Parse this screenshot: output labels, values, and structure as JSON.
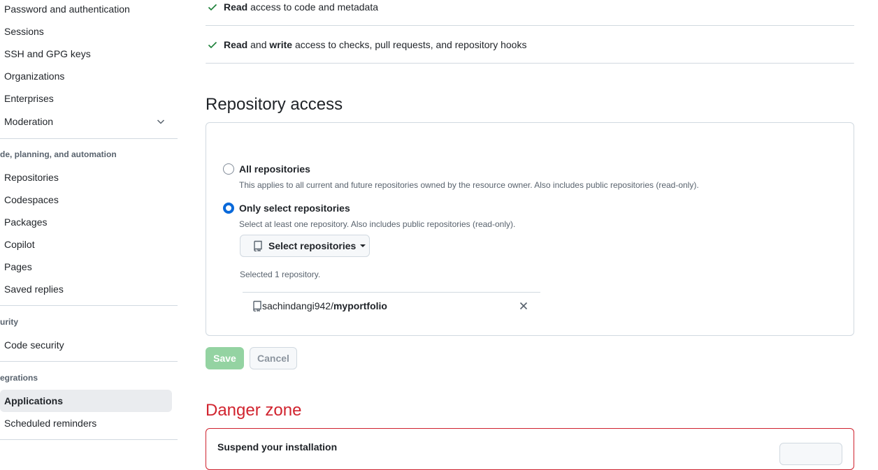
{
  "sidebar": {
    "items_top": [
      {
        "label": "Password and authentication"
      },
      {
        "label": "Sessions"
      },
      {
        "label": "SSH and GPG keys"
      },
      {
        "label": "Organizations"
      },
      {
        "label": "Enterprises"
      },
      {
        "label": "Moderation"
      }
    ],
    "heading_code": "de, planning, and automation",
    "items_code": [
      {
        "label": "Repositories"
      },
      {
        "label": "Codespaces"
      },
      {
        "label": "Packages"
      },
      {
        "label": "Copilot"
      },
      {
        "label": "Pages"
      },
      {
        "label": "Saved replies"
      }
    ],
    "heading_security": "urity",
    "items_security": [
      {
        "label": "Code security"
      }
    ],
    "heading_integrations": "egrations",
    "items_integrations": [
      {
        "label": "Applications",
        "active": true
      },
      {
        "label": "Scheduled reminders"
      }
    ]
  },
  "permissions": {
    "row1": {
      "strong": "Read",
      "rest": " access to code and metadata"
    },
    "row2": {
      "strong1": "Read",
      "mid": " and ",
      "strong2": "write",
      "rest": " access to checks, pull requests, and repository hooks"
    }
  },
  "repo_access": {
    "title": "Repository access",
    "all": {
      "label": "All repositories",
      "note": "This applies to all current and future repositories owned by the resource owner. Also includes public repositories (read-only).",
      "checked": false
    },
    "select": {
      "label": "Only select repositories",
      "note": "Select at least one repository. Also includes public repositories (read-only).",
      "checked": true
    },
    "select_button": "Select repositories",
    "selected_count": "Selected 1 repository.",
    "selected_repos": [
      {
        "owner": "sachindangi942/",
        "name": "myportfolio"
      }
    ]
  },
  "actions": {
    "save": "Save",
    "cancel": "Cancel"
  },
  "danger": {
    "title": "Danger zone",
    "suspend_title": "Suspend your installation"
  }
}
